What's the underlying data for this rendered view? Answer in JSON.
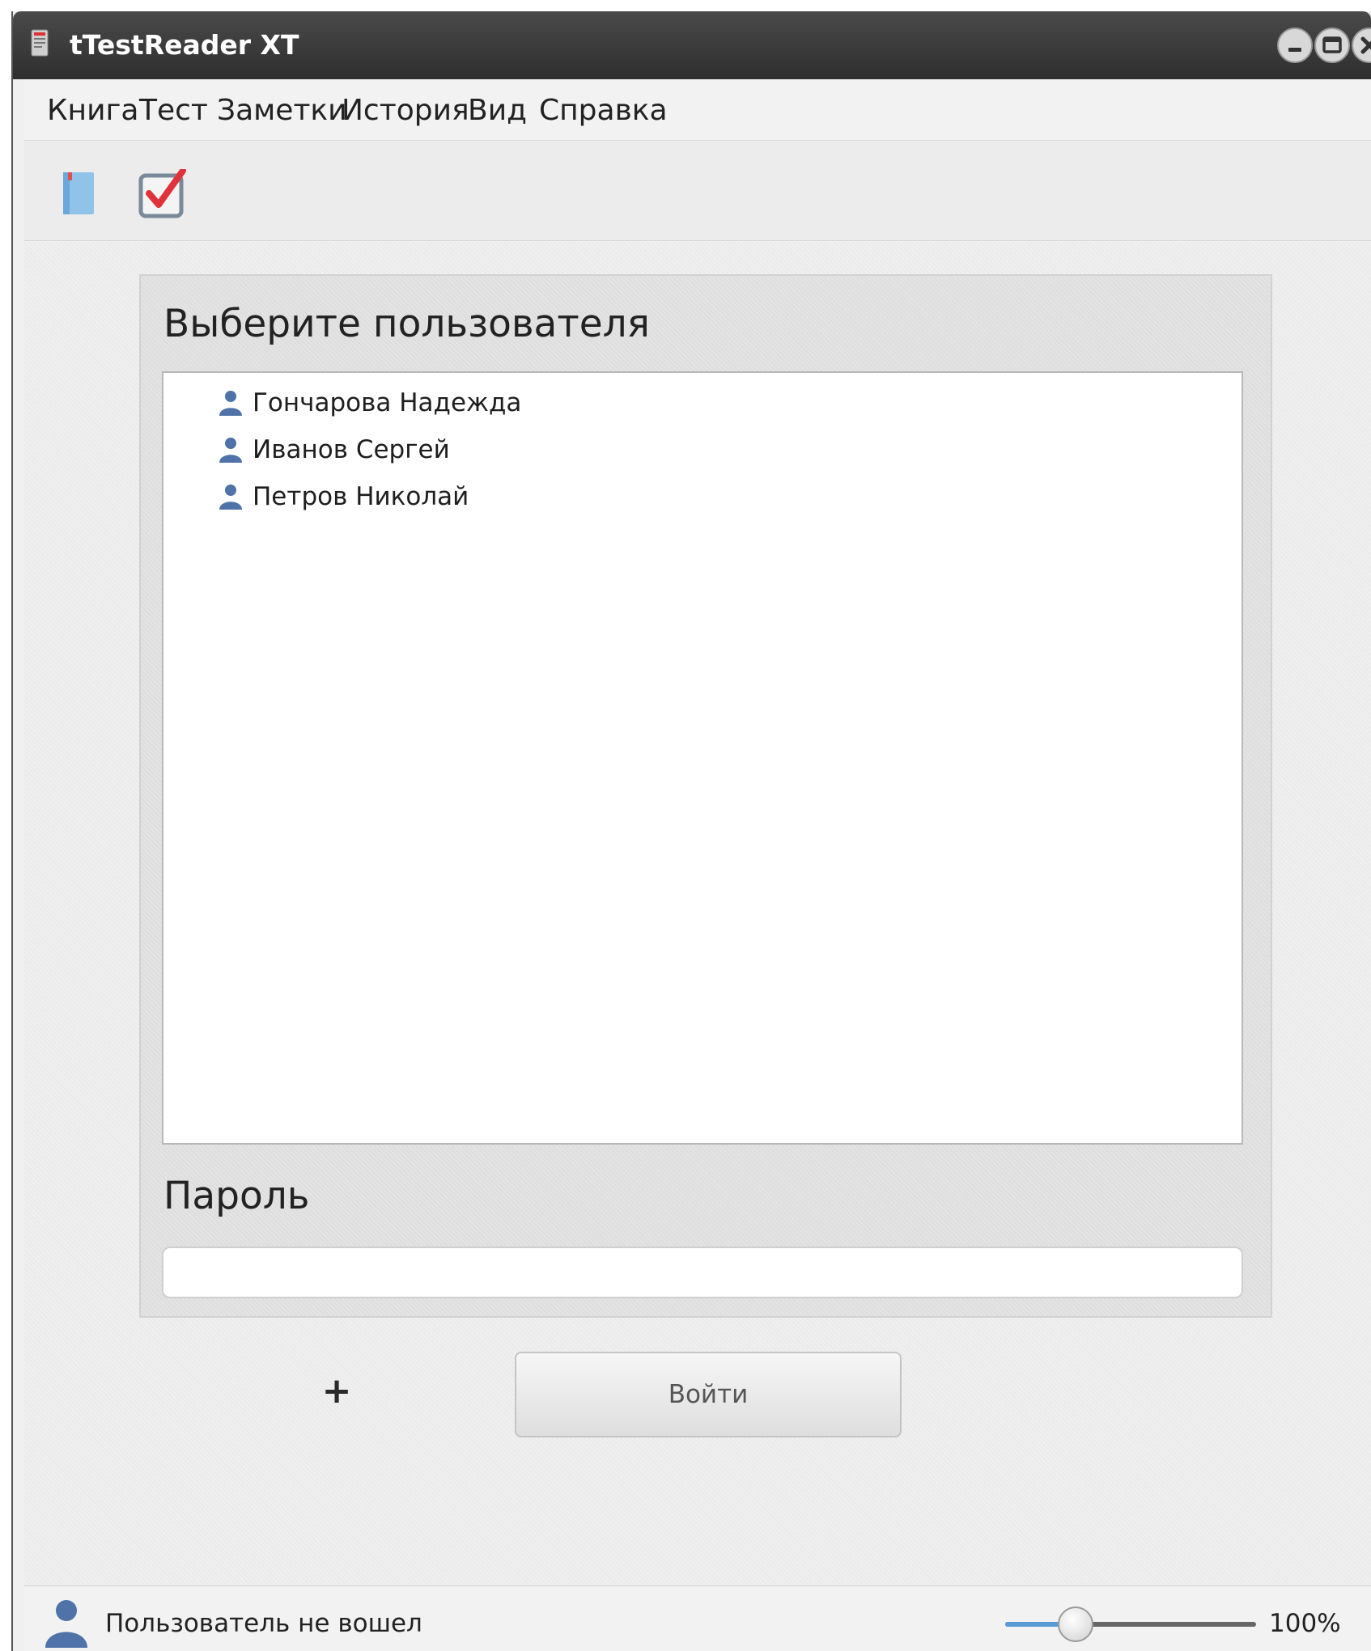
{
  "window": {
    "title": "tTestReader XT"
  },
  "menu": {
    "items": [
      {
        "label": "Книга"
      },
      {
        "label": "Тест"
      },
      {
        "label": "Заметки"
      },
      {
        "label": "История"
      },
      {
        "label": "Вид"
      },
      {
        "label": "Справка"
      }
    ]
  },
  "toolbar": {
    "buttons": [
      {
        "icon": "book-icon"
      },
      {
        "icon": "checkbox-test-icon"
      }
    ]
  },
  "login": {
    "heading": "Выберите пользователя",
    "users": [
      {
        "name": "Гончарова Надежда",
        "icon": "user-icon"
      },
      {
        "name": "Иванов Сергей",
        "icon": "user-icon"
      },
      {
        "name": "Петров Николай",
        "icon": "user-icon"
      }
    ],
    "password_label": "Пароль",
    "password_value": "",
    "add_label": "+",
    "login_button_label": "Войти"
  },
  "status": {
    "text": "Пользователь не вошел",
    "zoom_label": "100%",
    "zoom_slider_fraction": 0.28
  },
  "colors": {
    "titlebar": "#3a3a3a",
    "accent": "#5b9bd5",
    "user_icon": "#4f73a8",
    "check_mark": "#e0323a"
  }
}
